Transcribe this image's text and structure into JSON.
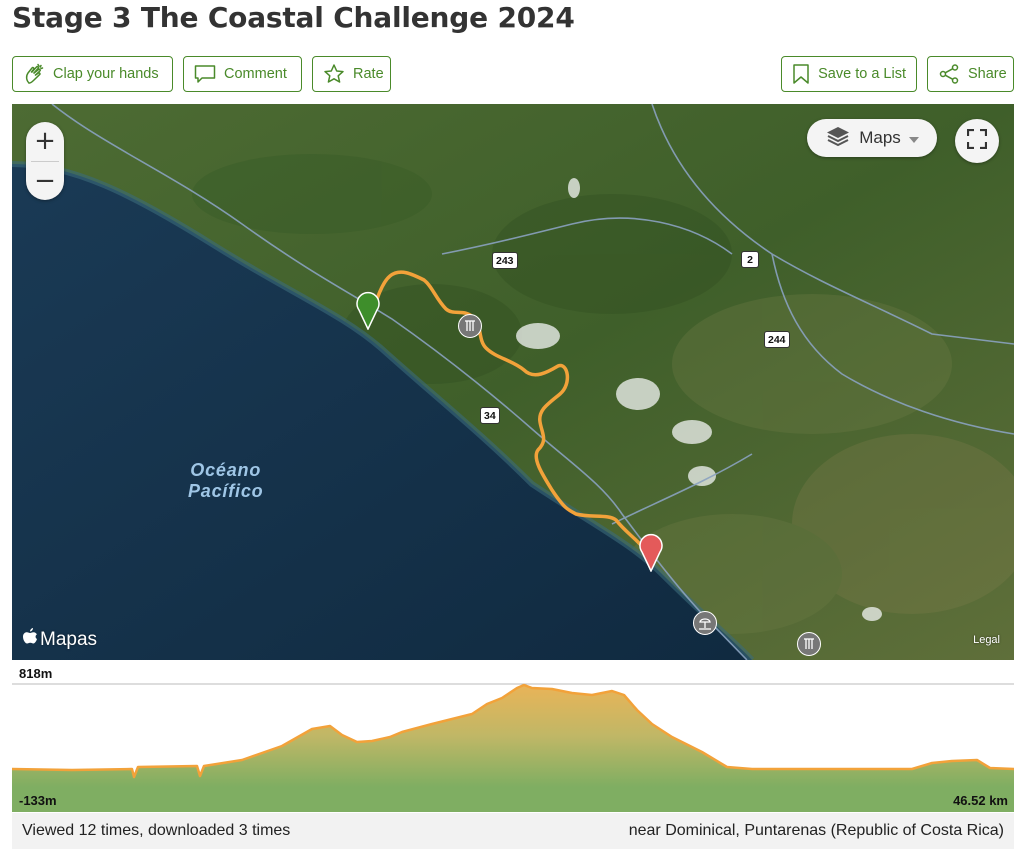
{
  "page": {
    "title": "Stage 3 The Coastal Challenge 2024"
  },
  "actions": {
    "clap_label": "Clap your hands",
    "comment_label": "Comment",
    "rate_label": "Rate",
    "save_label": "Save to a List",
    "share_label": "Share"
  },
  "map": {
    "zoom_in": "+",
    "zoom_out": "−",
    "layer_selector_label": "Maps",
    "ocean_label_line1": "Océano",
    "ocean_label_line2": "Pacífico",
    "roads": [
      "243",
      "2",
      "244",
      "34"
    ],
    "attribution": "Mapas",
    "legal": "Legal",
    "start_marker_color": "#3e8e2b",
    "end_marker_color": "#e45a5a",
    "route_color": "#f2a23a",
    "icons": [
      "waterfall-icon",
      "beach-icon",
      "waterfall-icon"
    ]
  },
  "elevation": {
    "max_label": "818m",
    "min_label": "-133m",
    "distance_label": "46.52 km"
  },
  "footer": {
    "views_text": "Viewed 12 times, downloaded 3 times",
    "location_text": "near Dominical, Puntarenas (Republic of Costa Rica)"
  },
  "colors": {
    "accent": "#4a8a2a"
  }
}
